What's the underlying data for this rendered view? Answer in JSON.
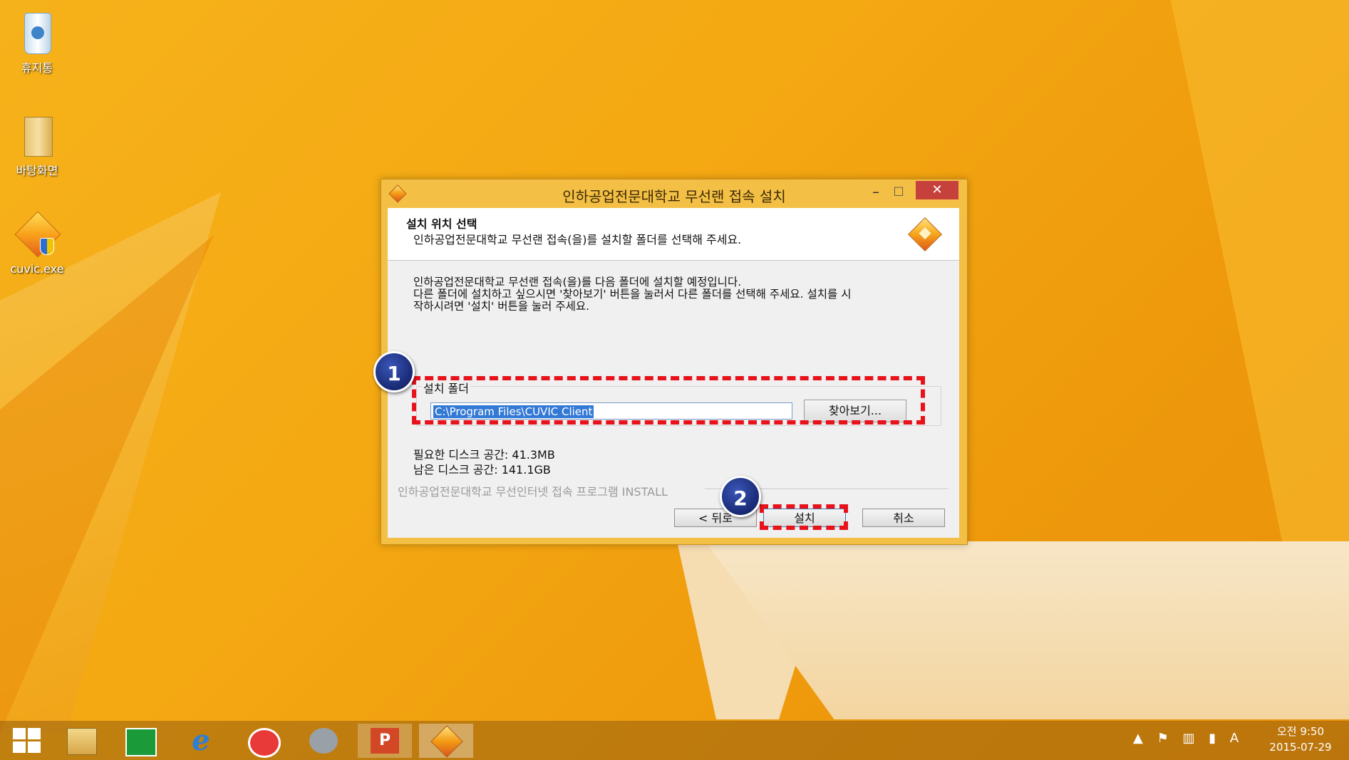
{
  "desktop": {
    "icons": [
      {
        "label": "휴지통",
        "icon": "recycle-bin-icon"
      },
      {
        "label": "바탕화면",
        "icon": "folder-icon"
      },
      {
        "label": "cuvic.exe",
        "icon": "installer-shield-icon"
      }
    ]
  },
  "dialog": {
    "title": "인하공업전문대학교 무선랜 접속 설치",
    "controls": {
      "minimize": "–",
      "maximize": "□",
      "close": "✕"
    },
    "header": {
      "title": "설치 위치 선택",
      "subtitle": "인하공업전문대학교 무선랜 접속(을)를 설치할 폴더를 선택해 주세요."
    },
    "description": [
      "인하공업전문대학교 무선랜 접속(을)를 다음 폴더에 설치할 예정입니다.",
      "다른 폴더에 설치하고 싶으시면 '찾아보기' 버튼을 눌러서 다른 폴더를 선택해 주세요. 설치를 시",
      "작하시려면 '설치' 버튼을 눌러 주세요."
    ],
    "folder_group_label": "설치 폴더",
    "install_path": "C:\\Program Files\\CUVIC Client",
    "browse_label": "찾아보기...",
    "space_required": "필요한 디스크 공간: 41.3MB",
    "space_available": "남은 디스크 공간: 141.1GB",
    "branding": "인하공업전문대학교 무선인터넷 접속 프로그램 INSTALL",
    "buttons": {
      "back": "< 뒤로",
      "install": "설치",
      "cancel": "취소"
    }
  },
  "annotations": {
    "step1": "1",
    "step2": "2",
    "highlight_color": "#e8121b",
    "badge_color": "#1f3190"
  },
  "taskbar": {
    "apps": [
      "start-icon",
      "file-explorer-icon",
      "store-icon",
      "internet-explorer-icon",
      "camera-app-icon",
      "tool-app-icon",
      "powerpoint-icon",
      "cuvic-installer-icon"
    ],
    "powerpoint_label": "P",
    "tray": {
      "caret": "▲",
      "flag": "⚑",
      "network": "▥",
      "signal": "▮",
      "ime": "A"
    },
    "clock": {
      "time": "오전 9:50",
      "date": "2015-07-29"
    }
  }
}
